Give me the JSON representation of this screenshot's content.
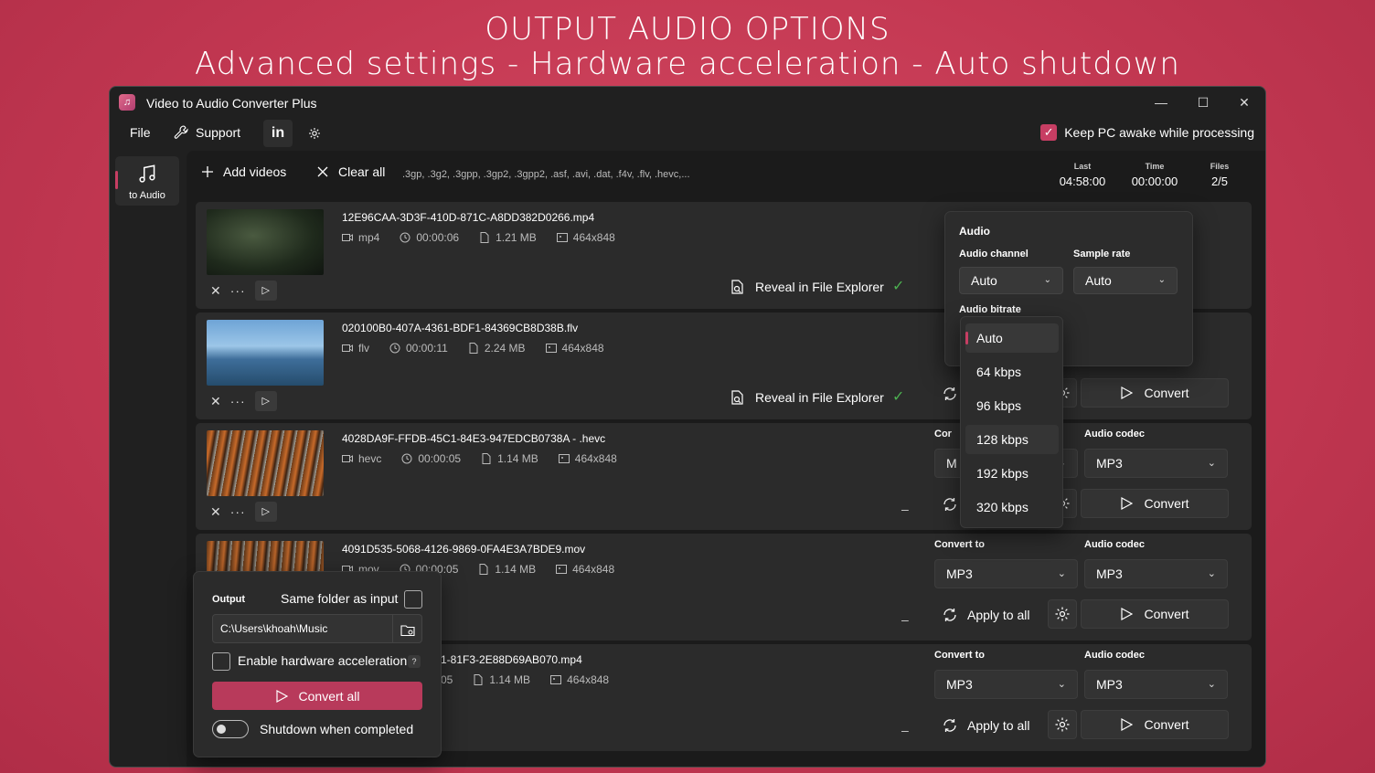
{
  "headline": {
    "line1": "OUTPUT AUDIO OPTIONS",
    "line2": "Advanced settings - Hardware acceleration - Auto shutdown"
  },
  "window": {
    "title": "Video to Audio Converter Plus",
    "controls": {
      "minimize": "—",
      "maximize": "☐",
      "close": "✕"
    }
  },
  "menubar": {
    "file": "File",
    "support": "Support",
    "linkedin": "in",
    "keep_awake": "Keep PC awake while processing",
    "keep_awake_checked": true
  },
  "nav": {
    "label": "to Audio"
  },
  "toolbar": {
    "add_videos": "Add videos",
    "clear_all": "Clear all",
    "formats": ".3gp, .3g2, .3gpp, .3gp2, .3gpp2, .asf, .avi, .dat, .f4v, .flv, .hevc,...",
    "stats": [
      {
        "key": "Last",
        "value": "04:58:00"
      },
      {
        "key": "Time",
        "value": "00:00:00"
      },
      {
        "key": "Files",
        "value": "2/5"
      }
    ]
  },
  "files": [
    {
      "name": "12E96CAA-3D3F-410D-871C-A8DD382D0266.mp4",
      "format": "mp4",
      "duration": "00:00:06",
      "size": "1.21 MB",
      "resolution": "464x848",
      "status": "done",
      "reveal": "Reveal in File Explorer"
    },
    {
      "name": "020100B0-407A-4361-BDF1-84369CB8D38B.flv",
      "format": "flv",
      "duration": "00:00:11",
      "size": "2.24 MB",
      "resolution": "464x848",
      "status": "done",
      "reveal": "Reveal in File Explorer"
    },
    {
      "name": "4028DA9F-FFDB-45C1-84E3-947EDCB0738A - .hevc",
      "format": "hevc",
      "duration": "00:00:05",
      "size": "1.14 MB",
      "resolution": "464x848",
      "status": "pending",
      "reveal": ""
    },
    {
      "name": "4091D535-5068-4126-9869-0FA4E3A7BDE9.mov",
      "format": "mov",
      "duration": "00:00:05",
      "size": "1.14 MB",
      "resolution": "464x848",
      "status": "pending",
      "reveal": ""
    },
    {
      "name": "1-81F3-2E88D69AB070.mp4",
      "format": "",
      "duration": "05",
      "size": "1.14 MB",
      "resolution": "464x848",
      "status": "pending",
      "reveal": ""
    }
  ],
  "row_panel": {
    "convert_to_label": "Convert to",
    "audio_codec_label": "Audio codec",
    "convert_to_value": "MP3",
    "audio_codec_value": "MP3",
    "apply_to_all": "Apply to all",
    "convert": "Convert",
    "pending_mark": "–",
    "done_mark": "✓",
    "partial_convert_label": "Cor",
    "partial_dd_value": "M"
  },
  "audio_popup": {
    "header": "Audio",
    "channel_label": "Audio channel",
    "channel_value": "Auto",
    "sample_rate_label": "Sample rate",
    "sample_rate_value": "Auto",
    "bitrate_label": "Audio bitrate",
    "bitrate_options": [
      "Auto",
      "64 kbps",
      "96 kbps",
      "128 kbps",
      "192 kbps",
      "320 kbps"
    ],
    "bitrate_selected": "Auto",
    "bitrate_hovered": "128 kbps"
  },
  "output_panel": {
    "output_label": "Output",
    "same_folder_label": "Same folder as input",
    "path": "C:\\Users\\khoah\\Music",
    "hw_accel_label": "Enable hardware acceleration",
    "help": "?",
    "convert_all": "Convert all",
    "shutdown_label": "Shutdown when completed"
  },
  "colors": {
    "accent": "#c73e63",
    "success": "#4cb050",
    "background": "#c33852"
  }
}
